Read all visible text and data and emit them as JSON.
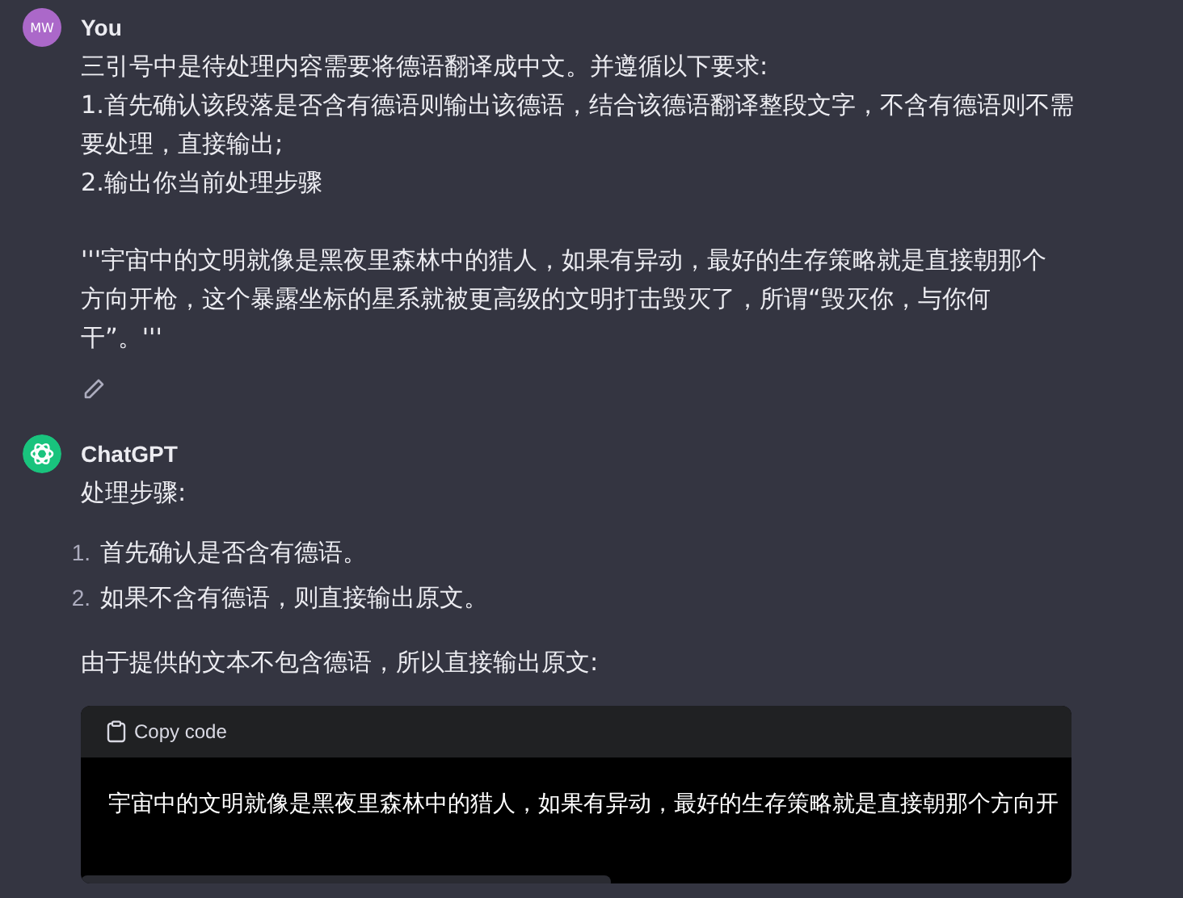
{
  "messages": [
    {
      "author": "You",
      "kind": "user",
      "avatar": "MW",
      "paragraphs": [
        "三引号中是待处理内容需要将德语翻译成中文。并遵循以下要求:",
        "1.首先确认该段落是否含有德语则输出该德语，结合该德语翻译整段文字，不含有德语则不需要处理，直接输出;",
        "2.输出你当前处理步骤"
      ],
      "quote": "'''宇宙中的文明就像是黑夜里森林中的猎人，如果有异动，最好的生存策略就是直接朝那个方向开枪，这个暴露坐标的星系就被更高级的文明打击毁灭了，所谓“毁灭你，与你何干”。'''"
    },
    {
      "author": "ChatGPT",
      "kind": "assistant",
      "intro": "处理步骤:",
      "steps": [
        {
          "number": "1.",
          "text": "首先确认是否含有德语。"
        },
        {
          "number": "2.",
          "text": "如果不含有德语，则直接输出原文。"
        }
      ],
      "after": "由于提供的文本不包含德语，所以直接输出原文:",
      "code": {
        "copy_label": "Copy code",
        "text": "宇宙中的文明就像是黑夜里森林中的猎人，如果有异动，最好的生存策略就是直接朝那个方向开"
      }
    }
  ]
}
